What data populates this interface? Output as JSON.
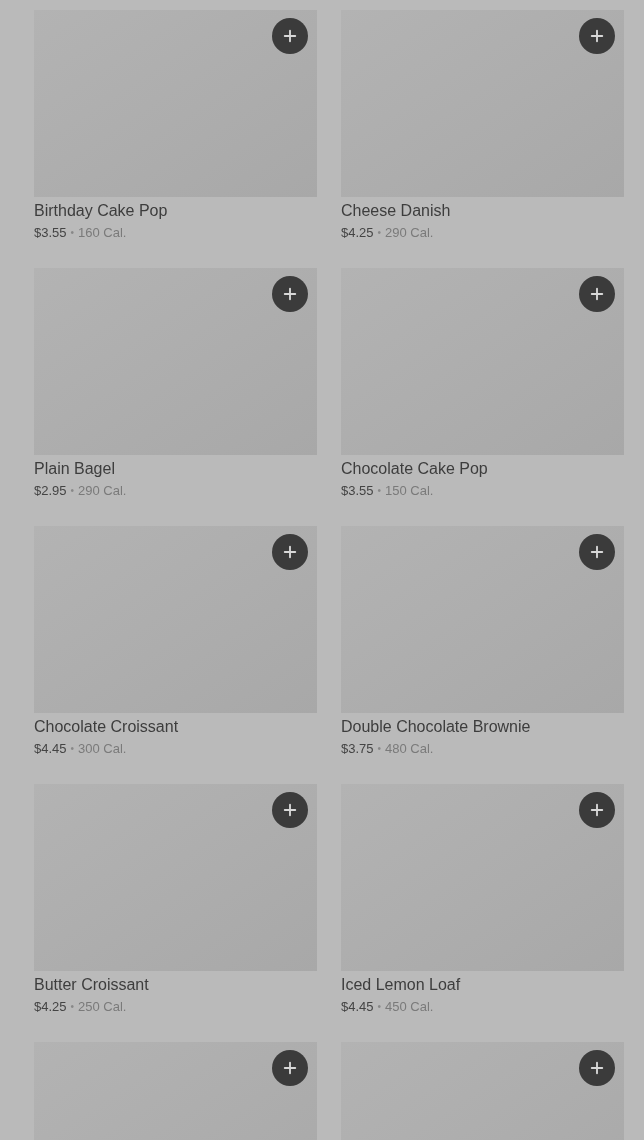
{
  "products": [
    {
      "kind": "product",
      "name": "Birthday Cake Pop",
      "price": "$3.55",
      "separator": "•",
      "calories": "160 Cal."
    },
    {
      "kind": "product",
      "name": "Cheese Danish",
      "price": "$4.25",
      "separator": "•",
      "calories": "290 Cal."
    },
    {
      "kind": "product",
      "name": "Plain Bagel",
      "price": "$2.95",
      "separator": "•",
      "calories": "290 Cal."
    },
    {
      "kind": "product",
      "name": "Chocolate Cake Pop",
      "price": "$3.55",
      "separator": "•",
      "calories": "150 Cal."
    },
    {
      "kind": "product",
      "name": "Chocolate Croissant",
      "price": "$4.45",
      "separator": "•",
      "calories": "300 Cal."
    },
    {
      "kind": "product",
      "name": "Double Chocolate Brownie",
      "price": "$3.75",
      "separator": "•",
      "calories": "480 Cal."
    },
    {
      "kind": "product",
      "name": "Butter Croissant",
      "price": "$4.25",
      "separator": "•",
      "calories": "250 Cal."
    },
    {
      "kind": "product",
      "name": "Iced Lemon Loaf",
      "price": "$4.45",
      "separator": "•",
      "calories": "450 Cal."
    },
    {
      "kind": "picture"
    },
    {
      "kind": "picture"
    }
  ]
}
